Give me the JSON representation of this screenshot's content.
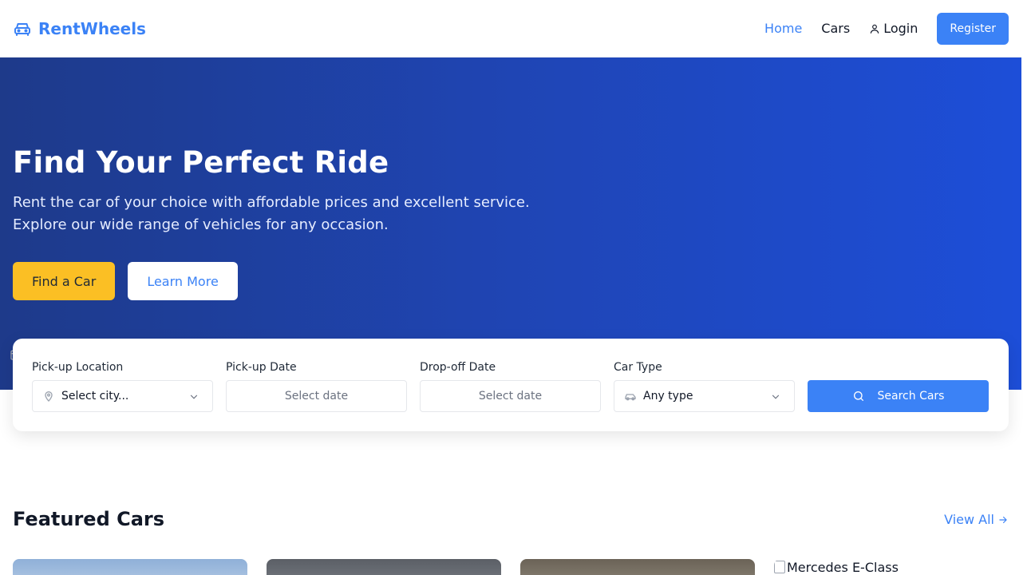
{
  "header": {
    "brand": "RentWheels",
    "nav": {
      "home": "Home",
      "cars": "Cars",
      "login": "Login"
    },
    "register": "Register"
  },
  "hero": {
    "title": "Find Your Perfect Ride",
    "subtitle_line1": "Rent the car of your choice with affordable prices and excellent service.",
    "subtitle_line2": "Explore our wide range of vehicles for any occasion.",
    "find_button": "Find a Car",
    "learn_button": "Learn More"
  },
  "search": {
    "pickup_location_label": "Pick-up Location",
    "pickup_location_value": "Select city...",
    "pickup_date_label": "Pick-up Date",
    "pickup_date_placeholder": "Select date",
    "dropoff_date_label": "Drop-off Date",
    "dropoff_date_placeholder": "Select date",
    "car_type_label": "Car Type",
    "car_type_value": "Any type",
    "search_button": "Search Cars"
  },
  "featured": {
    "title": "Featured Cars",
    "view_all": "View All",
    "cards": [
      {
        "alt": ""
      },
      {
        "alt": ""
      },
      {
        "alt": ""
      },
      {
        "alt": "Mercedes E-Class"
      }
    ]
  },
  "colors": {
    "accent": "#3b82f6",
    "hero_start": "#1e3a8a",
    "hero_end": "#1d4ed8",
    "find_button": "#fbbf24"
  },
  "icons": {
    "brand": "car-front-icon",
    "login": "user-icon",
    "location": "map-pin-icon",
    "calendar": "calendar-icon",
    "car_type": "car-icon",
    "chevron": "chevron-down-icon",
    "search": "search-icon",
    "arrow": "arrow-right-icon"
  }
}
